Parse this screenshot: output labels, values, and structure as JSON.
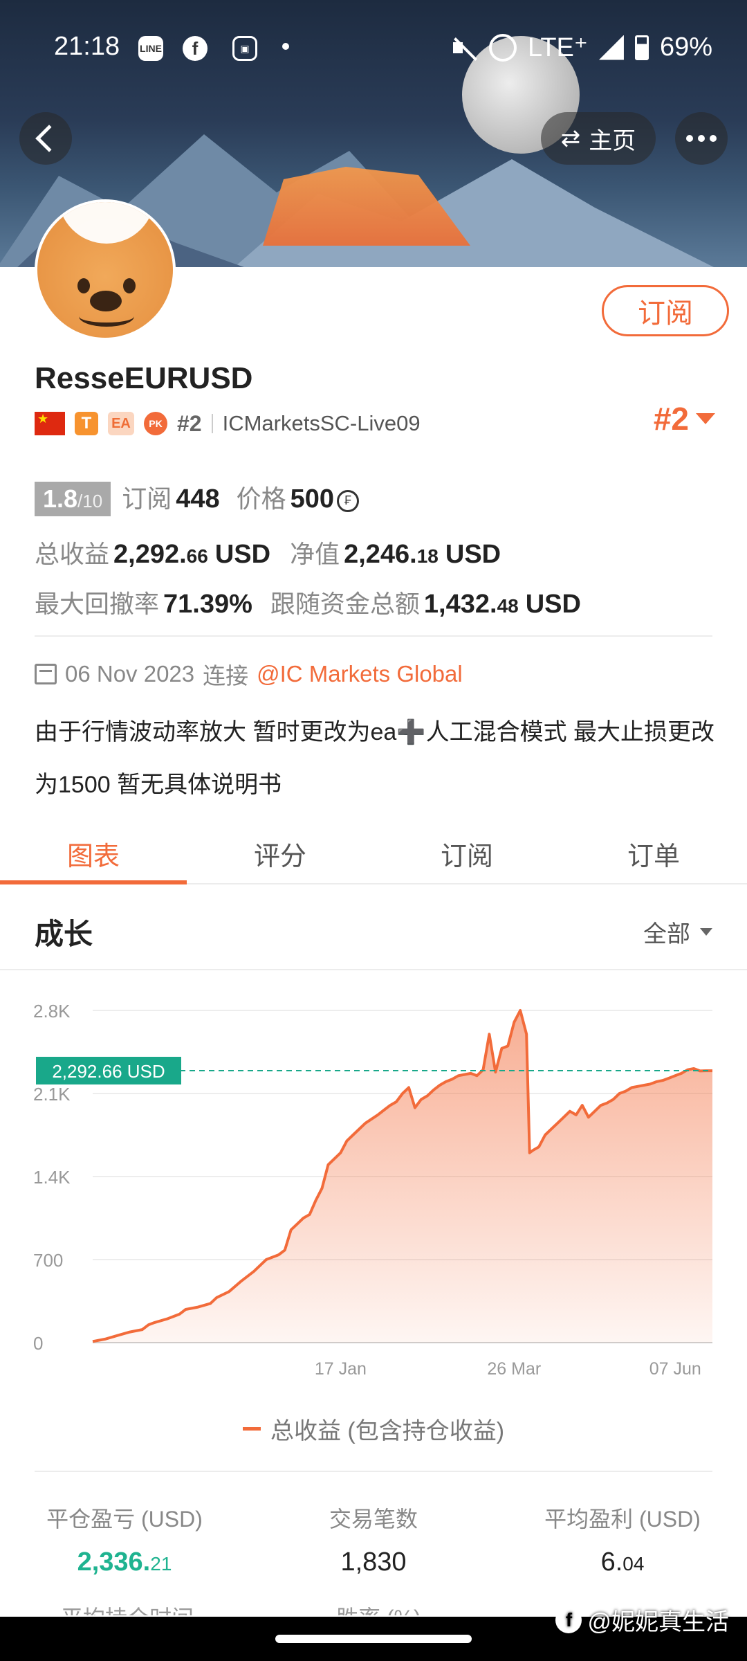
{
  "status_bar": {
    "time": "21:18",
    "network": "LTE⁺",
    "battery": "69%",
    "app_icons": [
      "line-icon",
      "facebook-icon",
      "card-icon"
    ]
  },
  "header": {
    "home_label": "主页",
    "subscribe_label": "订阅"
  },
  "profile": {
    "name": "ResseEURUSD",
    "badge_t": "T",
    "badge_ea": "EA",
    "badge_pk": "PK",
    "rank_small": "#2",
    "broker": "ICMarketsSC-Live09",
    "rank_big": "#2"
  },
  "stats": {
    "rating": "1.8",
    "rating_max": "/10",
    "subs_label": "订阅",
    "subs_value": "448",
    "price_label": "价格",
    "price_value": "500",
    "total_profit_label": "总收益",
    "total_profit_main": "2,292.",
    "total_profit_dec": "66",
    "total_profit_unit": "USD",
    "equity_label": "净值",
    "equity_main": "2,246.",
    "equity_dec": "18",
    "equity_unit": "USD",
    "drawdown_label": "最大回撤率",
    "drawdown_value": "71.39%",
    "follow_label": "跟随资金总额",
    "follow_main": "1,432.",
    "follow_dec": "48",
    "follow_unit": "USD"
  },
  "connection": {
    "date": "06 Nov 2023",
    "connect_label": "连接",
    "broker_link": "@IC Markets Global"
  },
  "description": "由于行情波动率放大 暂时更改为ea➕人工混合模式 最大止损更改为1500 暂无具体说明书",
  "tabs": [
    "图表",
    "评分",
    "订阅",
    "订单"
  ],
  "growth": {
    "title": "成长",
    "range": "全部",
    "legend": "总收益 (包含持仓收益)"
  },
  "chart_data": {
    "type": "area",
    "ylim": [
      0,
      2800
    ],
    "yticks": [
      "2.8K",
      "2.1K",
      "1.4K",
      "700",
      "0"
    ],
    "ytick_values": [
      2800,
      2100,
      1400,
      700,
      0
    ],
    "xticks": [
      "17 Jan",
      "26 Mar",
      "07 Jun"
    ],
    "current_label": "2,292.66 USD",
    "current_value": 2292.66,
    "color": "#f26b3a",
    "series": [
      {
        "name": "总收益 (包含持仓收益)",
        "x": [
          0,
          2,
          4,
          6,
          8,
          9,
          10,
          12,
          14,
          15,
          17,
          19,
          20,
          22,
          24,
          26,
          28,
          30,
          31,
          32,
          33,
          34,
          35,
          36,
          37,
          38,
          40,
          41,
          42,
          44,
          46,
          47,
          48,
          49,
          50,
          51,
          52,
          53,
          54,
          55,
          56,
          57,
          58,
          59,
          60,
          61,
          62,
          63,
          64,
          65,
          66,
          67,
          68,
          69,
          70,
          70.5,
          71,
          72,
          73,
          74,
          75,
          76,
          77,
          78,
          79,
          80,
          81,
          82,
          83,
          84,
          85,
          86,
          87,
          88,
          89,
          90,
          91,
          92,
          93,
          94,
          95,
          96,
          97,
          98,
          99,
          100
        ],
        "y": [
          10,
          30,
          60,
          90,
          110,
          150,
          170,
          200,
          240,
          280,
          300,
          330,
          380,
          430,
          520,
          600,
          700,
          740,
          780,
          950,
          1000,
          1050,
          1080,
          1200,
          1300,
          1500,
          1600,
          1700,
          1750,
          1850,
          1920,
          1960,
          2000,
          2030,
          2100,
          2150,
          1980,
          2050,
          2080,
          2130,
          2170,
          2200,
          2220,
          2250,
          2260,
          2270,
          2250,
          2300,
          2600,
          2280,
          2480,
          2500,
          2700,
          2800,
          2600,
          1600,
          1620,
          1650,
          1750,
          1800,
          1850,
          1900,
          1950,
          1920,
          2000,
          1900,
          1950,
          2000,
          2020,
          2050,
          2100,
          2120,
          2150,
          2160,
          2170,
          2180,
          2200,
          2210,
          2230,
          2250,
          2270,
          2300,
          2310,
          2290,
          2292,
          2292
        ]
      }
    ]
  },
  "summary": [
    {
      "label": "平仓盈亏 (USD)",
      "main": "2,336.",
      "dec": "21"
    },
    {
      "label": "交易笔数",
      "main": "1,830",
      "dec": ""
    },
    {
      "label": "平均盈利 (USD)",
      "main": "6.",
      "dec": "04"
    }
  ],
  "cut_labels": [
    "平均持仓时间",
    "胜率 (%)"
  ],
  "watermark": "@妮妮真生活"
}
